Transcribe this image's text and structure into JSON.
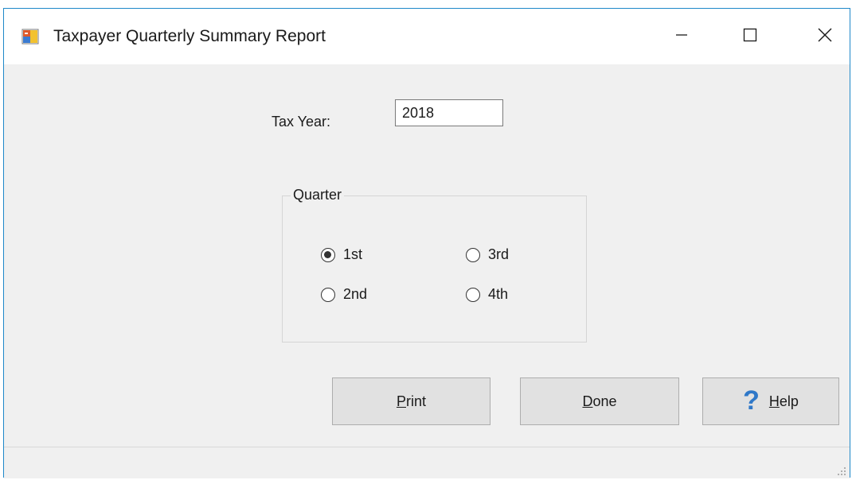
{
  "window": {
    "title": "Taxpayer Quarterly Summary Report",
    "controls": [
      "minimize-icon",
      "maximize-icon",
      "close-icon"
    ]
  },
  "form": {
    "tax_year_label": "Tax Year:",
    "tax_year_value": "2018"
  },
  "quarter": {
    "legend": "Quarter",
    "options": [
      {
        "label": "1st",
        "checked": true
      },
      {
        "label": "2nd",
        "checked": false
      },
      {
        "label": "3rd",
        "checked": false
      },
      {
        "label": "4th",
        "checked": false
      }
    ]
  },
  "buttons": {
    "print_mnemonic": "P",
    "print_rest": "rint",
    "done_mnemonic": "D",
    "done_rest": "one",
    "help_mnemonic": "H",
    "help_rest": "elp",
    "help_icon": "help-question-icon"
  },
  "colors": {
    "window_border": "#1e88c9",
    "help_icon": "#2f78c8"
  }
}
